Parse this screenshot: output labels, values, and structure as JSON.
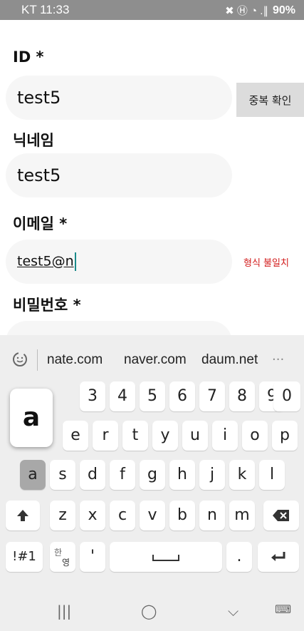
{
  "status_bar": {
    "carrier": "KT 11:33",
    "signal_icons": "✖ Ⓗ ◔ .∥",
    "battery": "90%"
  },
  "form": {
    "id_label": "ID *",
    "id_value": "test5",
    "dup_check_button": "중복 확인",
    "nickname_label": "닉네임",
    "nickname_value": "test5",
    "email_label": "이메일 *",
    "email_value": "test5@n",
    "email_error": "형식 불일치",
    "password_label": "비밀번호 *"
  },
  "keyboard": {
    "suggestions": [
      "nate.com",
      "naver.com",
      "daum.net"
    ],
    "more": "···",
    "preview_key": "a",
    "row_numbers": [
      "3",
      "4",
      "5",
      "6",
      "7",
      "8",
      "9",
      "0"
    ],
    "row_top": [
      "e",
      "r",
      "t",
      "y",
      "u",
      "i",
      "o",
      "p"
    ],
    "row_home": [
      "a",
      "s",
      "d",
      "f",
      "g",
      "h",
      "j",
      "k",
      "l"
    ],
    "row_bottom": [
      "z",
      "x",
      "c",
      "v",
      "b",
      "n",
      "m"
    ],
    "symbols_key": "!#1",
    "lang_key_top": "한",
    "lang_key_bottom": "영",
    "apostrophe_key": "'",
    "period_key": "."
  },
  "navigation": {
    "recent": "|||",
    "home": "◯",
    "back": "⌵",
    "keyboard_toggle": "⌨"
  }
}
